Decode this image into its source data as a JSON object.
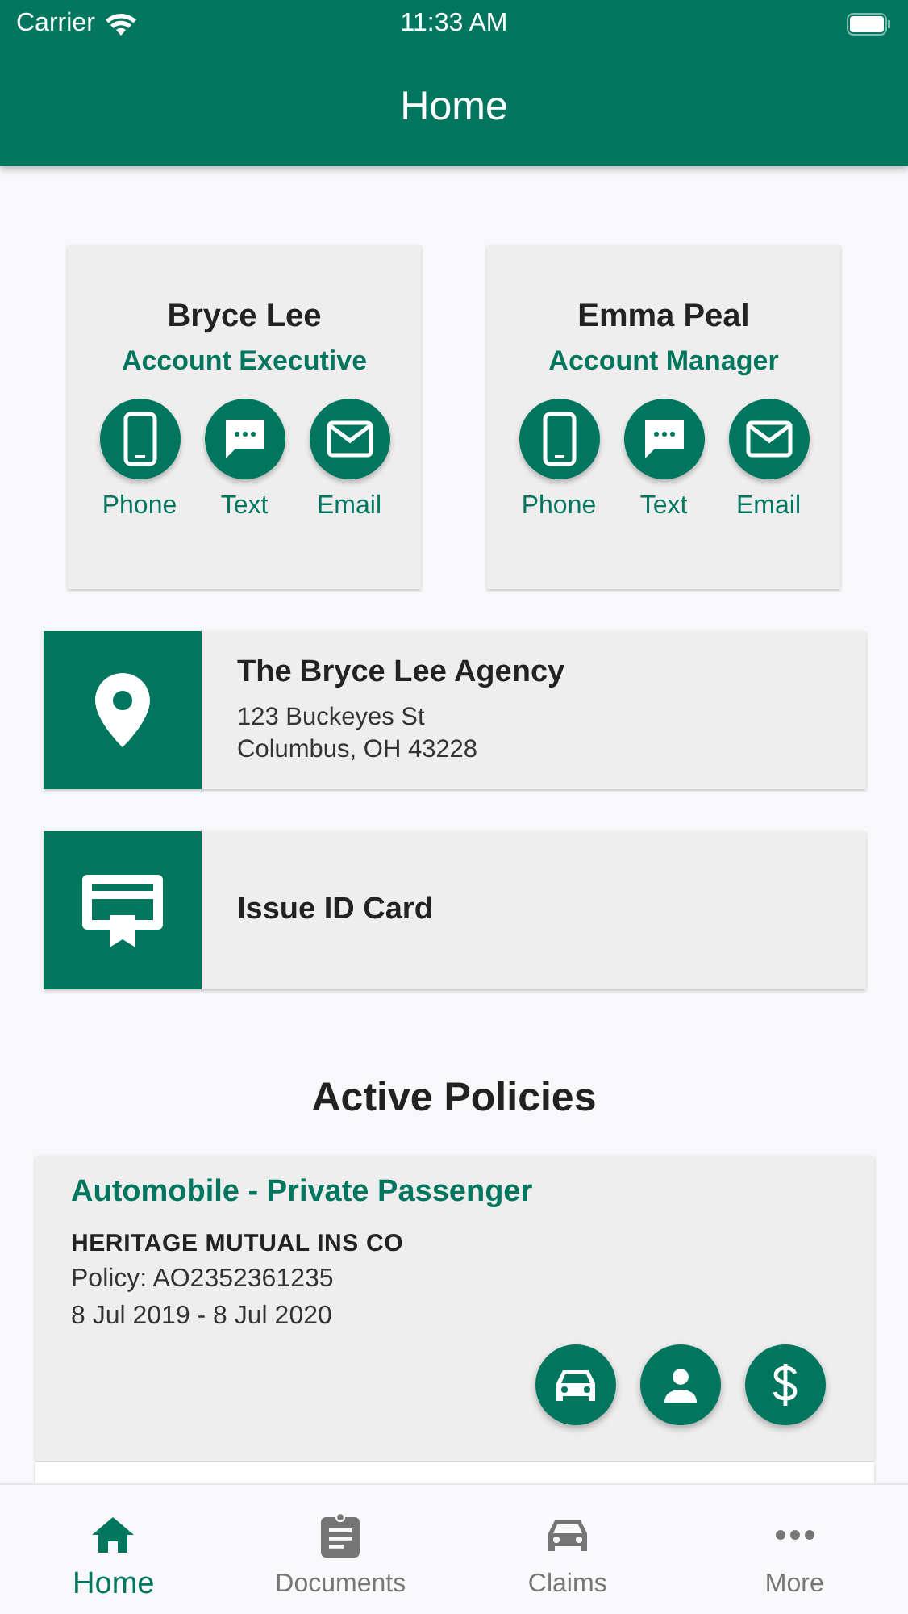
{
  "status_bar": {
    "carrier": "Carrier",
    "time": "11:33 AM"
  },
  "header": {
    "title": "Home"
  },
  "agents": [
    {
      "name": "Bryce Lee",
      "role": "Account Executive",
      "actions": [
        "Phone",
        "Text",
        "Email"
      ]
    },
    {
      "name": "Emma Peal",
      "role": "Account Manager",
      "actions": [
        "Phone",
        "Text",
        "Email"
      ]
    }
  ],
  "agency": {
    "name": "The Bryce Lee Agency",
    "address_lines": [
      "123 Buckeyes St",
      "Columbus, OH 43228"
    ]
  },
  "id_card": {
    "label": "Issue ID Card"
  },
  "policies_heading": "Active Policies",
  "policies": [
    {
      "title": "Automobile - Private Passenger",
      "insurer": "HERITAGE MUTUAL INS CO",
      "number": "Policy: AO2352361235",
      "period": "8 Jul 2019 - 8 Jul 2020"
    }
  ],
  "tabs": [
    {
      "label": "Home",
      "selected": true
    },
    {
      "label": "Documents",
      "selected": false
    },
    {
      "label": "Claims",
      "selected": false
    },
    {
      "label": "More",
      "selected": false
    }
  ]
}
